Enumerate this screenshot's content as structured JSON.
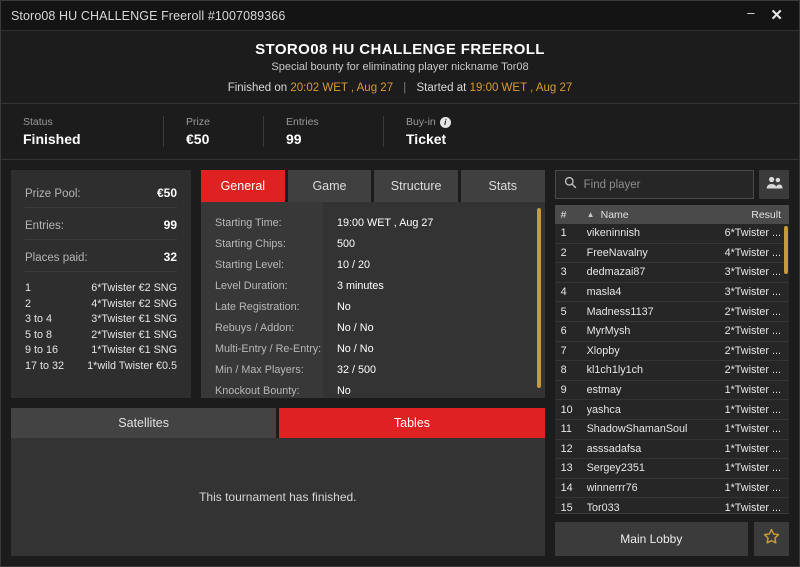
{
  "titlebar": {
    "title": "Storo08 HU CHALLENGE Freeroll #1007089366",
    "minimize_label": "–",
    "close_label": "✕"
  },
  "header": {
    "title": "STORO08 HU CHALLENGE FREEROLL",
    "subtitle": "Special bounty for eliminating player nickname Tor08",
    "finished_prefix": "Finished on",
    "finished_time": "20:02 WET , Aug 27",
    "divider": "|",
    "started_prefix": "Started at",
    "started_time": "19:00 WET , Aug 27"
  },
  "status": {
    "items": [
      {
        "label": "Status",
        "value": "Finished",
        "info": false
      },
      {
        "label": "Prize",
        "value": "€50",
        "info": false
      },
      {
        "label": "Entries",
        "value": "99",
        "info": false
      },
      {
        "label": "Buy-in",
        "value": "Ticket",
        "info": true
      }
    ]
  },
  "prize_pool": {
    "rows": [
      {
        "label": "Prize Pool:",
        "value": "€50"
      },
      {
        "label": "Entries:",
        "value": "99"
      },
      {
        "label": "Places paid:",
        "value": "32"
      }
    ],
    "payouts": [
      {
        "place": "1",
        "prize": "6*Twister €2 SNG"
      },
      {
        "place": "2",
        "prize": "4*Twister €2 SNG"
      },
      {
        "place": "3  to  4",
        "prize": "3*Twister €1 SNG"
      },
      {
        "place": "5  to  8",
        "prize": "2*Twister €1 SNG"
      },
      {
        "place": "9  to  16",
        "prize": "1*Twister €1 SNG"
      },
      {
        "place": "17  to  32",
        "prize": "1*wild Twister €0.5"
      }
    ]
  },
  "tabs": {
    "items": [
      {
        "label": "General",
        "active": true
      },
      {
        "label": "Game",
        "active": false
      },
      {
        "label": "Structure",
        "active": false
      },
      {
        "label": "Stats",
        "active": false
      }
    ]
  },
  "general": {
    "rows": [
      {
        "label": "Starting Time:",
        "value": "19:00 WET , Aug 27"
      },
      {
        "label": "Starting Chips:",
        "value": "500"
      },
      {
        "label": "Starting Level:",
        "value": "10 / 20"
      },
      {
        "label": "Level Duration:",
        "value": "3 minutes"
      },
      {
        "label": "Late Registration:",
        "value": "No"
      },
      {
        "label": "Rebuys / Addon:",
        "value": "No / No"
      },
      {
        "label": "Multi-Entry / Re-Entry:",
        "value": "No / No"
      },
      {
        "label": "Min / Max Players:",
        "value": "32 / 500"
      },
      {
        "label": "Knockout Bounty:",
        "value": "No"
      }
    ]
  },
  "lower_tabs": {
    "items": [
      {
        "label": "Satellites",
        "active": false
      },
      {
        "label": "Tables",
        "active": true
      }
    ],
    "message": "This tournament has finished."
  },
  "search": {
    "placeholder": "Find player",
    "icon": "search-icon",
    "players_icon": "people-icon"
  },
  "player_list": {
    "columns": {
      "num": "#",
      "sort": "▲",
      "name": "Name",
      "result": "Result"
    },
    "rows": [
      {
        "num": "1",
        "name": "vikeninnish",
        "result": "6*Twister ..."
      },
      {
        "num": "2",
        "name": "FreeNavalny",
        "result": "4*Twister ..."
      },
      {
        "num": "3",
        "name": "dedmazai87",
        "result": "3*Twister ..."
      },
      {
        "num": "4",
        "name": "masla4",
        "result": "3*Twister ..."
      },
      {
        "num": "5",
        "name": "Madness1137",
        "result": "2*Twister ..."
      },
      {
        "num": "6",
        "name": "MyrMysh",
        "result": "2*Twister ..."
      },
      {
        "num": "7",
        "name": "Xlopby",
        "result": "2*Twister ..."
      },
      {
        "num": "8",
        "name": "kl1ch1ly1ch",
        "result": "2*Twister ..."
      },
      {
        "num": "9",
        "name": "estmay",
        "result": "1*Twister ..."
      },
      {
        "num": "10",
        "name": "yashca",
        "result": "1*Twister ..."
      },
      {
        "num": "11",
        "name": "ShadowShamanSoul",
        "result": "1*Twister ..."
      },
      {
        "num": "12",
        "name": "asssadafsa",
        "result": "1*Twister ..."
      },
      {
        "num": "13",
        "name": "Sergey2351",
        "result": "1*Twister ..."
      },
      {
        "num": "14",
        "name": "winnerrr76",
        "result": "1*Twister ..."
      },
      {
        "num": "15",
        "name": "Tor033",
        "result": "1*Twister ..."
      }
    ]
  },
  "footer": {
    "lobby_label": "Main Lobby",
    "star_icon": "star-icon"
  },
  "colors": {
    "accent_red": "#e02121",
    "amber": "#d79a34",
    "panel": "#2e2e2e",
    "background": "#1c1c1c"
  }
}
